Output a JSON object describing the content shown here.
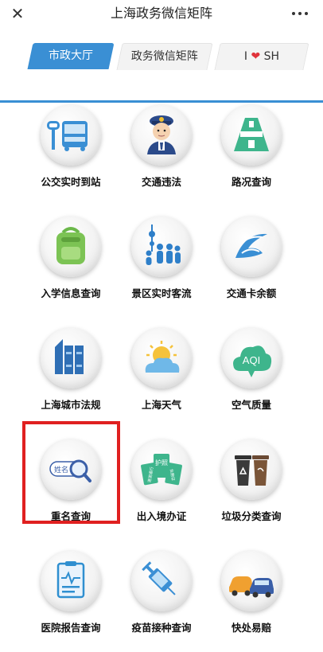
{
  "header": {
    "title": "上海政务微信矩阵",
    "close_glyph": "✕",
    "more_glyph": "•••"
  },
  "tabs": [
    {
      "label": "市政大厅",
      "active": true
    },
    {
      "label": "政务微信矩阵",
      "active": false
    },
    {
      "label_before": "I",
      "label_heart": "❤",
      "label_after": "SH",
      "active": false
    }
  ],
  "grid": [
    {
      "label": "公交实时到站",
      "icon": "bus-icon"
    },
    {
      "label": "交通违法",
      "icon": "traffic-police-icon"
    },
    {
      "label": "路况查询",
      "icon": "road-icon"
    },
    {
      "label": "入学信息查询",
      "icon": "school-bag-icon"
    },
    {
      "label": "景区实时客流",
      "icon": "crowd-tower-icon"
    },
    {
      "label": "交通卡余额",
      "icon": "transit-card-icon"
    },
    {
      "label": "上海城市法规",
      "icon": "law-books-icon"
    },
    {
      "label": "上海天气",
      "icon": "weather-icon"
    },
    {
      "label": "空气质量",
      "icon": "aqi-cloud-icon",
      "icon_text": "AQI"
    },
    {
      "label": "重名查询",
      "icon": "name-search-icon",
      "icon_text": "姓名"
    },
    {
      "label": "出入境办证",
      "icon": "passport-icon",
      "icon_text": [
        "护照",
        "港澳通行",
        "台胞证"
      ]
    },
    {
      "label": "垃圾分类查询",
      "icon": "trash-bins-icon"
    },
    {
      "label": "医院报告查询",
      "icon": "medical-report-icon"
    },
    {
      "label": "疫苗接种查询",
      "icon": "vaccine-syringe-icon"
    },
    {
      "label": "快处易赔",
      "icon": "car-accident-icon"
    }
  ],
  "colors": {
    "accent": "#3a8fd4",
    "highlight": "#e02020",
    "heart": "#e0333b"
  }
}
